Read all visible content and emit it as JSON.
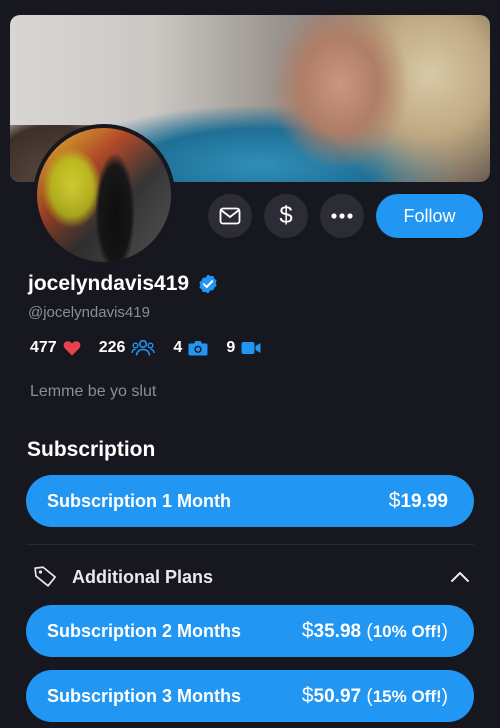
{
  "profile": {
    "username": "jocelyndavis419",
    "handle": "@jocelyndavis419",
    "bio": "Lemme be yo slut",
    "verified": true
  },
  "actions": {
    "message_icon": "envelope-icon",
    "tip_label": "$",
    "more_icon": "more-dots-icon",
    "follow_label": "Follow"
  },
  "stats": {
    "likes": "477",
    "followers": "226",
    "photos": "4",
    "videos": "9"
  },
  "subscription": {
    "title": "Subscription",
    "main_plan": {
      "name": "Subscription 1 Month",
      "currency": "$",
      "price": "19.99"
    }
  },
  "additional_plans": {
    "title": "Additional Plans",
    "expanded": true,
    "plans": [
      {
        "name": "Subscription 2 Months",
        "currency": "$",
        "price": "35.98",
        "discount": "10% Off!"
      },
      {
        "name": "Subscription 3 Months",
        "currency": "$",
        "price": "50.97",
        "discount": "15% Off!"
      }
    ]
  },
  "colors": {
    "background": "#17171f",
    "accent": "#2196f3",
    "muted_text": "#8a8d9a",
    "heart": "#e8424f",
    "icon_blue": "#2196f3"
  }
}
